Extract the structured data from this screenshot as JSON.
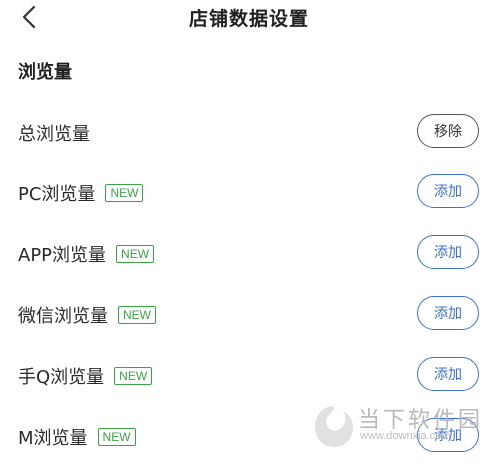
{
  "header": {
    "title": "店铺数据设置",
    "back_icon": "chevron-left-icon"
  },
  "section": {
    "title": "浏览量"
  },
  "rows": [
    {
      "name": "总浏览量",
      "badge": "",
      "action": "移除",
      "type": "remove"
    },
    {
      "name": "PC浏览量",
      "badge": "NEW",
      "action": "添加",
      "type": "add"
    },
    {
      "name": "APP浏览量",
      "badge": "NEW",
      "action": "添加",
      "type": "add"
    },
    {
      "name": "微信浏览量",
      "badge": "NEW",
      "action": "添加",
      "type": "add"
    },
    {
      "name": "手Q浏览量",
      "badge": "NEW",
      "action": "添加",
      "type": "add"
    },
    {
      "name": "M浏览量",
      "badge": "NEW",
      "action": "添加",
      "type": "add"
    }
  ],
  "watermark": {
    "name": "当下软件园",
    "url": "www.downxia.com"
  },
  "colors": {
    "accent": "#3c6fd6",
    "new_badge": "#3aa346",
    "remove_border": "#555555"
  }
}
